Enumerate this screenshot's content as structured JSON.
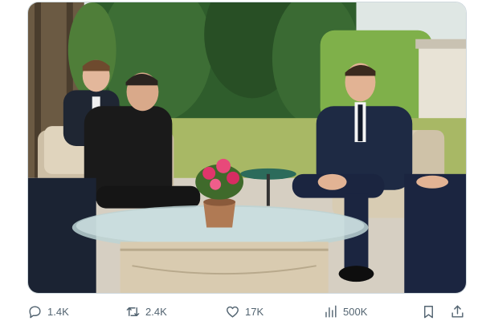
{
  "photo": {
    "alt": ""
  },
  "actions": {
    "reply_count": "1.4K",
    "retweet_count": "2.4K",
    "like_count": "17K",
    "views_count": "500K"
  },
  "icons": {
    "reply": "reply-icon",
    "retweet": "retweet-icon",
    "like": "heart-icon",
    "views": "views-chart-icon",
    "bookmark": "bookmark-icon",
    "share": "share-icon"
  },
  "colors": {
    "action_gray": "#536471",
    "border": "#cfd9de"
  }
}
